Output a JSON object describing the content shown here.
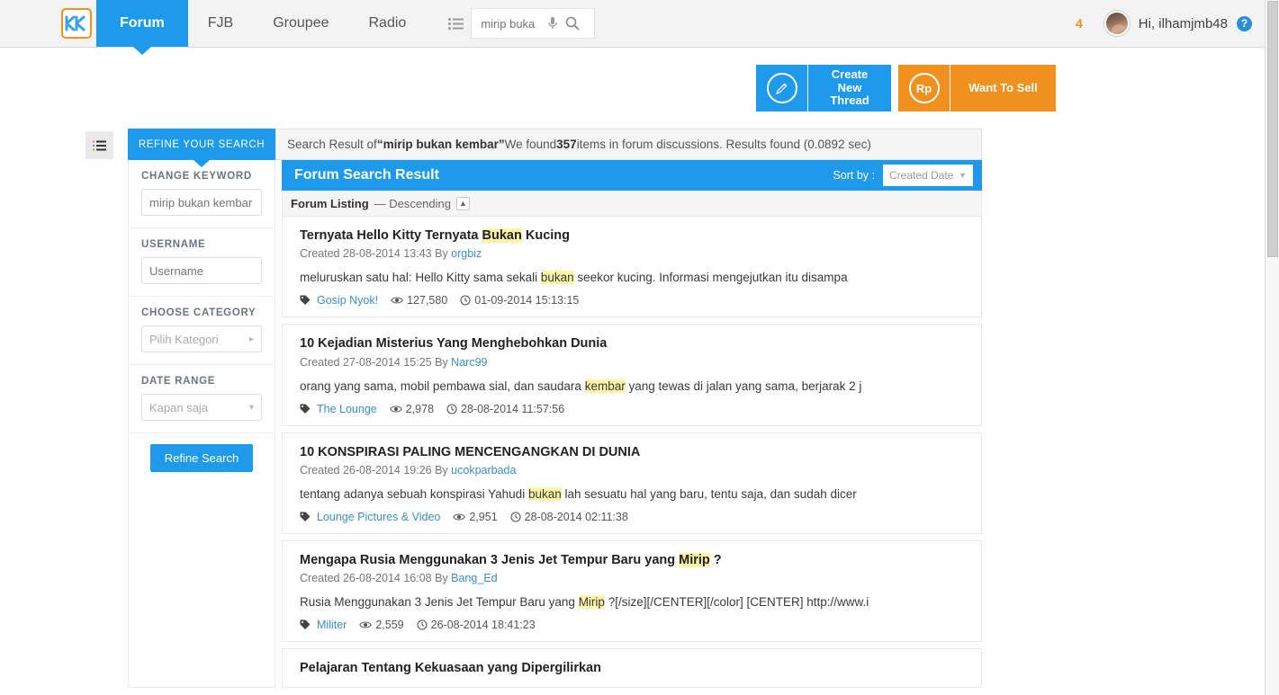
{
  "nav": {
    "logo_text": "K",
    "items": [
      {
        "label": "Forum",
        "active": true
      },
      {
        "label": "FJB",
        "active": false
      },
      {
        "label": "Groupee",
        "active": false
      },
      {
        "label": "Radio",
        "active": false
      }
    ],
    "list_icon": "list-icon",
    "search_value": "mirip buka",
    "search_placeholder": "mirip buka",
    "mic_icon": "microphone-icon",
    "search_icon": "search-icon",
    "notification_count": "4",
    "greeting": "Hi, ilhamjmb48",
    "help_icon": "help-icon",
    "colors": {
      "accent_blue": "#1e9aeb",
      "accent_orange": "#f0901e",
      "logo_border": "#f0921e"
    }
  },
  "actions": [
    {
      "label": "Create New Thread",
      "icon": "pencil-icon",
      "color": "#1e9aeb"
    },
    {
      "label": "Want To Sell",
      "icon": "rupiah-icon",
      "icon_text": "Rp",
      "color": "#f0901e"
    }
  ],
  "sidebar_toggle_icon": "list-toggle-icon",
  "refine": {
    "tab_label": "REFINE YOUR SEARCH",
    "groups": [
      {
        "label": "CHANGE KEYWORD",
        "type": "input",
        "value": "",
        "placeholder": "mirip bukan kembar"
      },
      {
        "label": "USERNAME",
        "type": "input",
        "value": "",
        "placeholder": "Username"
      },
      {
        "label": "CHOOSE CATEGORY",
        "type": "select",
        "value": "Pilih Kategori",
        "arrow": "▸"
      },
      {
        "label": "DATE RANGE",
        "type": "select",
        "value": "Kapan saja",
        "arrow": "▾"
      }
    ],
    "submit_label": "Refine Search"
  },
  "result_bar": {
    "prefix": "Search Result of ",
    "query": "“mirip bukan kembar”",
    "middle": " We found ",
    "count": "357",
    "suffix": " items in forum discussions. Results found (0.0892 sec)"
  },
  "results_panel": {
    "title": "Forum Search Result",
    "sort_label": "Sort by :",
    "sort_value": "Created Date",
    "listing_label": "Forum Listing",
    "listing_order": "— Descending",
    "collapse_icon": "chevron-up-icon"
  },
  "results": [
    {
      "title_parts": [
        {
          "text": "Ternyata Hello Kitty Ternyata ",
          "hl": false
        },
        {
          "text": "Bukan",
          "hl": true
        },
        {
          "text": " Kucing",
          "hl": false
        }
      ],
      "created": "Created 28-08-2014 13:43 By ",
      "author": "orgbiz",
      "snippet_parts": [
        {
          "text": "meluruskan satu hal: Hello Kitty sama sekali ",
          "hl": false
        },
        {
          "text": "bukan",
          "hl": true
        },
        {
          "text": " seekor kucing. Informasi mengejutkan itu disampa",
          "hl": false
        }
      ],
      "category": "Gosip Nyok!",
      "views": "127,580",
      "date": "01-09-2014 15:13:15"
    },
    {
      "title_parts": [
        {
          "text": "10 Kejadian Misterius Yang Menghebohkan Dunia",
          "hl": false
        }
      ],
      "created": "Created 27-08-2014 15:25 By ",
      "author": "Narc99",
      "snippet_parts": [
        {
          "text": "orang yang sama, mobil pembawa sial, dan saudara ",
          "hl": false
        },
        {
          "text": "kembar",
          "hl": true
        },
        {
          "text": " yang tewas di jalan yang sama, berjarak 2 j",
          "hl": false
        }
      ],
      "category": "The Lounge",
      "views": "2,978",
      "date": "28-08-2014 11:57:56"
    },
    {
      "title_parts": [
        {
          "text": "10 KONSPIRASI PALING MENCENGANGKAN DI DUNIA",
          "hl": false
        }
      ],
      "created": "Created 26-08-2014 19:26 By ",
      "author": "ucokparbada",
      "snippet_parts": [
        {
          "text": "tentang adanya sebuah konspirasi Yahudi ",
          "hl": false
        },
        {
          "text": "bukan",
          "hl": true
        },
        {
          "text": " lah sesuatu hal yang baru, tentu saja, dan sudah dicer",
          "hl": false
        }
      ],
      "category": "Lounge Pictures & Video",
      "views": "2,951",
      "date": "28-08-2014 02:11:38"
    },
    {
      "title_parts": [
        {
          "text": "Mengapa Rusia Menggunakan 3 Jenis Jet Tempur Baru yang ",
          "hl": false
        },
        {
          "text": "Mirip",
          "hl": true
        },
        {
          "text": " ?",
          "hl": false
        }
      ],
      "created": "Created 26-08-2014 16:08 By ",
      "author": "Bang_Ed",
      "snippet_parts": [
        {
          "text": "Rusia Menggunakan 3 Jenis Jet Tempur Baru yang ",
          "hl": false
        },
        {
          "text": "Mirip",
          "hl": true
        },
        {
          "text": " ?[/size][/CENTER][/color] [CENTER] http://www.i",
          "hl": false
        }
      ],
      "category": "Militer",
      "views": "2,559",
      "date": "26-08-2014 18:41:23"
    },
    {
      "title_parts": [
        {
          "text": "Pelajaran Tentang Kekuasaan yang Dipergilirkan",
          "hl": false
        }
      ],
      "created": "",
      "author": "",
      "snippet_parts": [],
      "category": "",
      "views": "",
      "date": ""
    }
  ],
  "icons": {
    "tag": "tag-icon",
    "eye": "eye-icon",
    "clock": "clock-icon"
  }
}
